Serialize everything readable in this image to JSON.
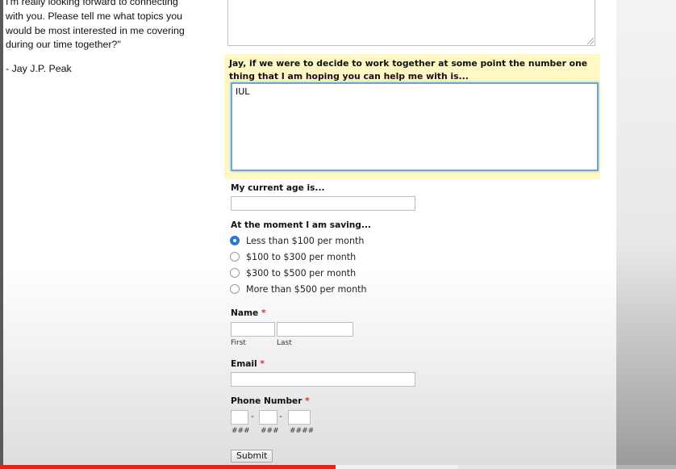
{
  "testimonial": {
    "quote_lines": [
      "I'm really looking forward to connecting",
      "with you. Please tell me what topics you",
      "would be most interested in me covering",
      "during our time together?\""
    ],
    "signature": "- Jay J.P. Peak"
  },
  "form": {
    "goal": {
      "label": "Jay, if we were to decide to work together at some point the number one thing that I am hoping you can help me with is...",
      "value": "IUL"
    },
    "age": {
      "label": "My current age is...",
      "value": ""
    },
    "saving": {
      "label": "At the moment I am saving...",
      "options": [
        {
          "label": "Less than $100 per month",
          "checked": true
        },
        {
          "label": "$100 to $300 per month",
          "checked": false
        },
        {
          "label": "$300 to $500 per month",
          "checked": false
        },
        {
          "label": "More than $500 per month",
          "checked": false
        }
      ]
    },
    "name": {
      "label": "Name",
      "required_mark": "*",
      "first_label": "First",
      "last_label": "Last"
    },
    "email": {
      "label": "Email",
      "required_mark": "*"
    },
    "phone": {
      "label": "Phone Number",
      "required_mark": "*",
      "separator": "-",
      "hints": [
        "###",
        "###",
        "####"
      ]
    },
    "submit_label": "Submit"
  },
  "video": {
    "progress_fraction": 0.497,
    "buffered_fraction": 0.678,
    "played_color": "#e62117"
  },
  "colors": {
    "highlight": "#fff8c4",
    "focus_border": "#6fa4d4",
    "required": "#d03030",
    "radio_checked": "#2b78d0"
  }
}
